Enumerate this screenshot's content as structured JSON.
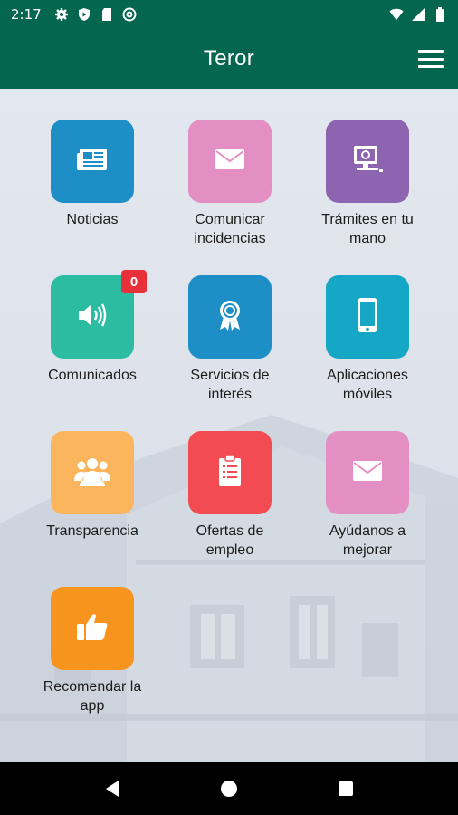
{
  "status_bar": {
    "time": "2:17",
    "left_icons": [
      "gear-icon",
      "play-protect-icon",
      "sd-card-icon",
      "at-sign-icon"
    ],
    "right_icons": [
      "wifi-icon",
      "cellular-signal-icon",
      "battery-icon"
    ]
  },
  "app_bar": {
    "title": "Teror",
    "menu_icon": "hamburger-menu-icon"
  },
  "tiles": [
    {
      "id": "noticias",
      "label": "Noticias",
      "icon": "newspaper-icon",
      "color": "#1e8fc6"
    },
    {
      "id": "comunicar-incidencias",
      "label": "Comunicar\nincidencias",
      "icon": "envelope-icon",
      "color": "#e48fc4"
    },
    {
      "id": "tramites",
      "label": "Trámites en tu\nmano",
      "icon": "computer-icon",
      "color": "#8c64b0"
    },
    {
      "id": "comunicados",
      "label": "Comunicados",
      "icon": "speaker-icon",
      "color": "#2bbca2",
      "badge": "0"
    },
    {
      "id": "servicios",
      "label": "Servicios de\ninterés",
      "icon": "award-ribbon-icon",
      "color": "#1e8fc6"
    },
    {
      "id": "aplicaciones",
      "label": "Aplicaciones\nmóviles",
      "icon": "smartphone-icon",
      "color": "#16a6c6"
    },
    {
      "id": "transparencia",
      "label": "Transparencia",
      "icon": "group-people-icon",
      "color": "#fbb55c"
    },
    {
      "id": "ofertas",
      "label": "Ofertas de\nempleo",
      "icon": "clipboard-icon",
      "color": "#f24b52"
    },
    {
      "id": "ayudanos",
      "label": "Ayúdanos a\nmejorar",
      "icon": "envelope-icon",
      "color": "#e48fc4"
    },
    {
      "id": "recomendar",
      "label": "Recomendar la\napp",
      "icon": "thumbs-up-icon",
      "color": "#f7941d"
    }
  ],
  "nav_bar": {
    "back_icon": "back-triangle-icon",
    "home_icon": "home-circle-icon",
    "recents_icon": "recents-square-icon"
  }
}
